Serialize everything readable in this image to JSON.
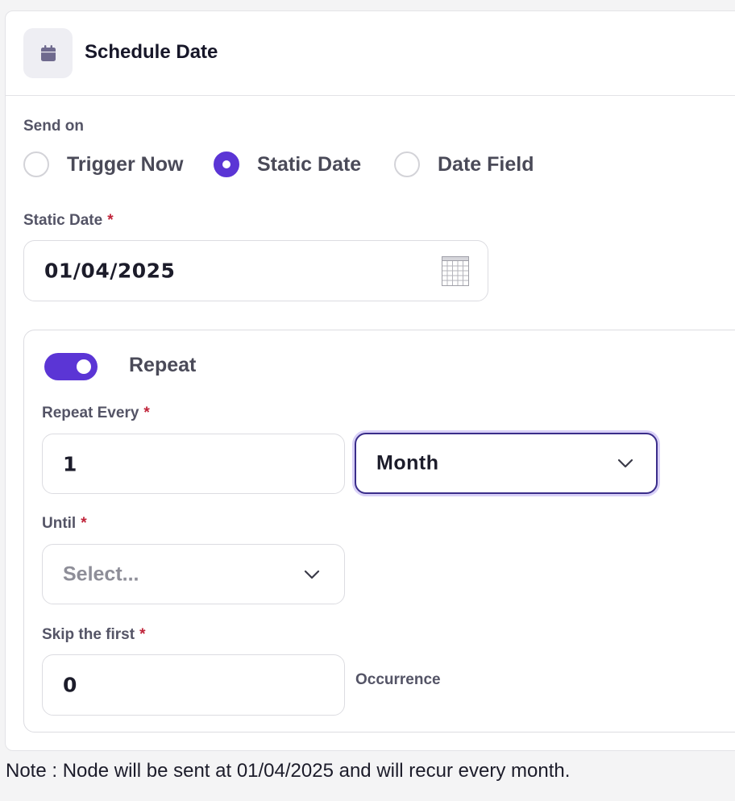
{
  "header": {
    "title": "Schedule Date",
    "icon": "calendar-icon"
  },
  "send_on": {
    "label": "Send on",
    "options": [
      {
        "label": "Trigger Now",
        "selected": false
      },
      {
        "label": "Static Date",
        "selected": true
      },
      {
        "label": "Date Field",
        "selected": false
      }
    ]
  },
  "static_date": {
    "label": "Static Date",
    "required_mark": "*",
    "value": "01/04/2025",
    "icon": "calendar-grid-icon"
  },
  "repeat": {
    "toggle_on": true,
    "label": "Repeat",
    "every": {
      "label": "Repeat Every",
      "required_mark": "*",
      "count": "1",
      "unit": "Month"
    },
    "until": {
      "label": "Until",
      "required_mark": "*",
      "placeholder": "Select..."
    },
    "skip": {
      "label": "Skip the first",
      "required_mark": "*",
      "value": "0",
      "suffix": "Occurrence"
    }
  },
  "note": "Note : Node will be sent at 01/04/2025 and will recur every month.",
  "colors": {
    "accent": "#5b35d5",
    "required": "#c0243a",
    "focus_border": "#3a2d8a"
  }
}
